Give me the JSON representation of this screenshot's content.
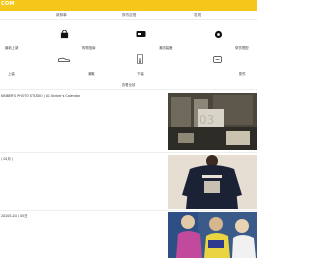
{
  "header": {
    "brand": "COM"
  },
  "nav": {
    "items": [
      "新鲜事",
      "穿衣百搭",
      "发现"
    ]
  },
  "categories": [
    {
      "label": "最新上新",
      "icon": "new-icon"
    },
    {
      "label": "购物指南",
      "icon": "shopping-guide-icon"
    },
    {
      "label": "潮流装备",
      "icon": "gear-icon"
    },
    {
      "label": "穿衣搭配",
      "icon": "outfit-icon"
    },
    {
      "label": "上装",
      "icon": "top-icon"
    },
    {
      "label": "潮鞋",
      "icon": "sneaker-icon"
    },
    {
      "label": "下装",
      "icon": "pants-icon"
    },
    {
      "label": "配件",
      "icon": "accessory-icon"
    }
  ],
  "more_label": "查看全部",
  "feed": [
    {
      "title": "KINBER'S PHOTO STUDIO | 01 Kinber's Calendar",
      "image": "magazine-photo"
    },
    {
      "title": "( 02月 )",
      "image": "sweatshirt-photo"
    },
    {
      "title": "2020S-04 / 05日",
      "image": "group-photo"
    }
  ]
}
